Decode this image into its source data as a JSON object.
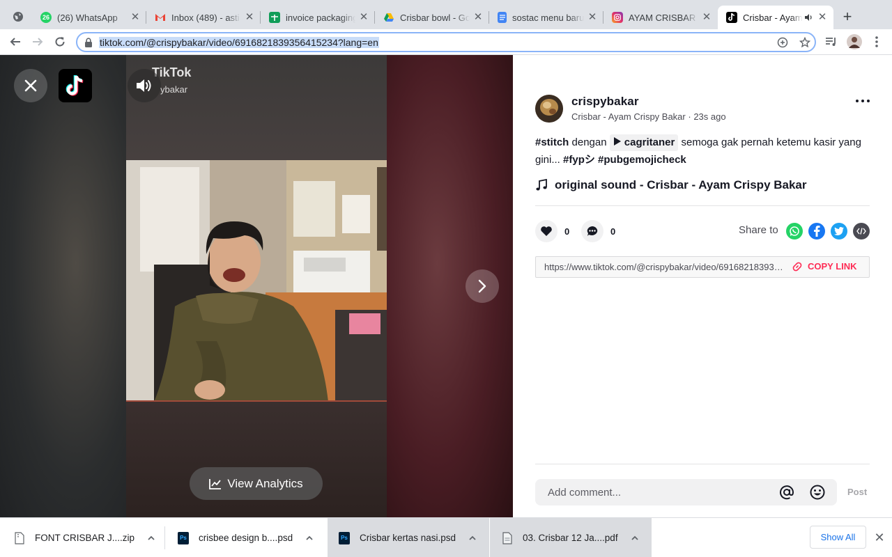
{
  "browser": {
    "tabs": [
      {
        "title": "(26) WhatsApp",
        "icon": "whatsapp-icon",
        "badge": "26",
        "color": "#25d366"
      },
      {
        "title": "Inbox (489) - asti",
        "icon": "gmail-icon",
        "color": "#ea4335"
      },
      {
        "title": "invoice packaging",
        "icon": "sheets-icon",
        "color": "#0f9d58"
      },
      {
        "title": "Crisbar bowl - Go",
        "icon": "drive-icon",
        "color": "#fbbc04"
      },
      {
        "title": "sostac menu baru",
        "icon": "docs-icon",
        "color": "#4285f4"
      },
      {
        "title": "AYAM CRISBAR (@",
        "icon": "instagram-icon",
        "color": "#c13584"
      },
      {
        "title": "Crisbar - Ayam",
        "icon": "tiktok-icon",
        "color": "#000000",
        "active": true
      }
    ],
    "url": "tiktok.com/@crispybakar/video/6916821839356415234?lang=en"
  },
  "video": {
    "watermark": "TikTok",
    "watermark_user": "ybakar",
    "analytics_label": "View Analytics"
  },
  "post": {
    "username": "crispybakar",
    "display_name": "Crisbar - Ayam Crispy Bakar",
    "time_ago": "23s ago",
    "caption": {
      "tag_stitch": "#stitch",
      "word_dengan": "dengan",
      "mention": "cagritaner",
      "text": "semoga gak pernah ketemu kasir yang gini...",
      "tag_fyp": "#fypシ",
      "tag_pubg": "#pubgemojicheck"
    },
    "sound": "original sound - Crisbar - Ayam Crispy Bakar",
    "likes": "0",
    "comments": "0",
    "share_label": "Share to",
    "share_link": "https://www.tiktok.com/@crispybakar/video/6916821839356415234",
    "copy_link_label": "COPY LINK",
    "comment_placeholder": "Add comment...",
    "post_label": "Post"
  },
  "downloads": {
    "items": [
      {
        "name": "FONT CRISBAR J....zip",
        "type": "zip"
      },
      {
        "name": "crisbee design b....psd",
        "type": "psd"
      },
      {
        "name": "Crisbar kertas nasi.psd",
        "type": "psd"
      },
      {
        "name": "03. Crisbar 12 Ja....pdf",
        "type": "pdf"
      }
    ],
    "show_all": "Show All"
  },
  "colors": {
    "accent": "#fe2c55",
    "whatsapp": "#25d366",
    "facebook": "#1877f2",
    "twitter": "#1da1f2",
    "embed": "#4a4a52"
  }
}
